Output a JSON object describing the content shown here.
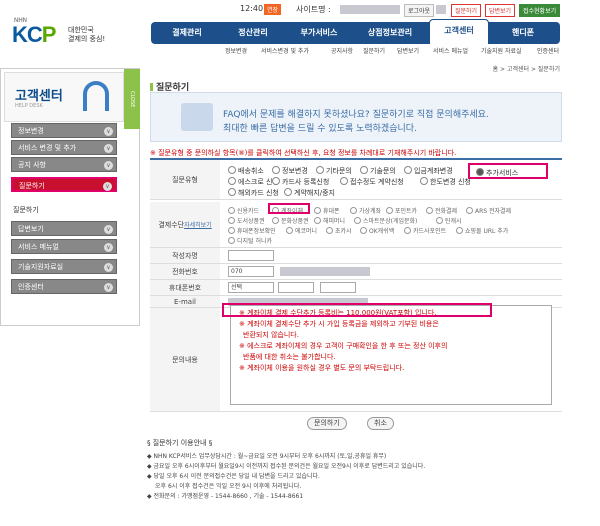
{
  "logo": {
    "nhn": "NHN",
    "brand_a": "KC",
    "brand_b": "P",
    "tag1": "대한민국",
    "tag2": "결제의 중심!"
  },
  "topbar": {
    "time": "12:40",
    "badge": "연장",
    "site_label": "사이트명 :",
    "logout": "로그아웃",
    "btn1": "질문하기",
    "btn2": "답변보기",
    "btn3": "접수현황보기"
  },
  "gnb": [
    "결제관리",
    "정산관리",
    "부가서비스",
    "상점정보관리",
    "고객센터",
    "핸디폰"
  ],
  "subnav": [
    "정보변경",
    "서비스변경 및 추가",
    "공지사항",
    "질문하기",
    "답변보기",
    "서비스 메뉴얼",
    "기술지원 자료실",
    "인증센터"
  ],
  "side": {
    "title": "고객센터",
    "sub": "HELP DESK",
    "close": "CLOSE",
    "items": [
      "정보변경",
      "서비스 변경 및 추가",
      "공지 사항",
      "질문하기",
      "답변보기",
      "서비스 메뉴얼",
      "기술지원자료실",
      "인증센터"
    ],
    "sub_item": "질문하기"
  },
  "crumb": "홈 > 고객센터 > 질문하기",
  "page_title": "질문하기",
  "intro": {
    "t1": "FAQ에서 문제를 해결하지 못하셨나요? 질문하기로 직접 문의해주세요.",
    "t2": "최대한 빠른 답변을 드릴 수 있도록 노력하겠습니다."
  },
  "warn": "※ 질문유형 중 문의하실 항목(⑧)를 클릭하여 선택하신 후, 요청 정보를 차례대로 기재해주시기 바랍니다.",
  "labels": {
    "type": "질문유형",
    "pay": "결제수단",
    "pay_link": "자세히보기",
    "name": "작성자명",
    "phone": "전화번호",
    "mobile": "휴대폰번호",
    "email": "E-mail",
    "content": "문의내용"
  },
  "types": [
    [
      "배송취소",
      "정보변경",
      "기타문의",
      "기술문의",
      "입금계좌변경",
      "추가서비스"
    ],
    [
      "에스크로 신청",
      "카드사 등록신청",
      "접수정도 계약신청",
      "한도변경 신청"
    ],
    [
      "해외카드 신청",
      "계약해지/중지"
    ]
  ],
  "pays": [
    [
      "신용카드",
      "계좌이체",
      "휴대폰",
      "가상계좌",
      "포인트카",
      "전화결제",
      "ARS 전자결제"
    ],
    [
      "도서상품권",
      "문화상품권",
      "해피머니",
      "스마트문상(게임문화)",
      "틴캐시"
    ],
    [
      "휴대폰정보확인",
      "에코머니",
      "초카시",
      "OK캐쉬백",
      "카드사포인트",
      "쇼핑몰 URL 추가"
    ],
    [
      "디지털 허니카"
    ]
  ],
  "phone": {
    "area": "070",
    "mobile": "선택"
  },
  "textarea": [
    "※ 계좌이체 결제 수단추가 등록비는 110,000원(VAT포함) 입니다.",
    "※ 계좌이체 결제수단 추가 시 가입 등록금을 제외하고 기부된 비용은",
    "반환되지 않습니다.",
    "※ 에스크로 계좌이체의 경우 고객이 구매확인을 한 후 또는 정산 이후의",
    "반품에 대한 취소는 불가합니다.",
    "※ 계좌이체 이용을 원하실 경우 별도 문의 부탁드립니다."
  ],
  "buttons": {
    "ask": "문의하기",
    "cancel": "취소"
  },
  "guide": {
    "head": "§ 질문하기 이용안내 §",
    "lines": [
      "◆ NHN KCP서비스 업무상담시간 : 월~금요일 오전 9시부터 오후 6시까지 (토,일,공휴일 휴무)",
      "◆ 금요일 오후 6시이후부터 월요일9시 이전까지 접수된 문의건은 월요일 오전9시 이후로 답변드리고 있습니다.",
      "◆ 당일 오후 6시 이전 문의접수건은 당일 내 답변을 드리고 있습니다.",
      "오후 6시 이후 접수건은 익일 오전 9시 이후에 처리됩니다.",
      "◆ 전화문의 : 가맹점운영 - 1544-8660 , 기술 - 1544-8661"
    ]
  }
}
